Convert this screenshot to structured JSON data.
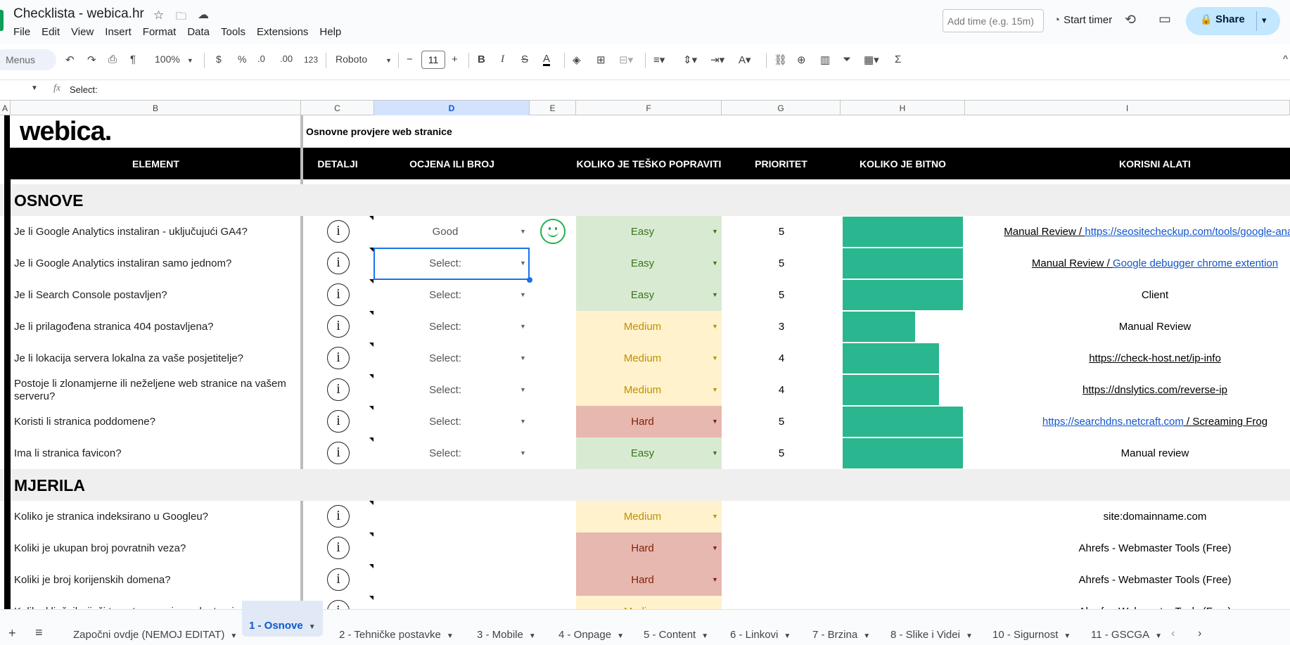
{
  "app": {
    "title": "Checklista - webica.hr",
    "menu": [
      "File",
      "Edit",
      "View",
      "Insert",
      "Format",
      "Data",
      "Tools",
      "Extensions",
      "Help"
    ],
    "add_time_placeholder": "Add time (e.g. 15m)",
    "start_timer": "Start timer",
    "share": "Share"
  },
  "toolbar": {
    "menus_search": "Menus",
    "zoom": "100%",
    "currency": "$",
    "percent": "%",
    "dec_decrease": ".0",
    "dec_increase": ".00",
    "number_format": "123",
    "font": "Roboto",
    "font_size": "11",
    "minus": "−",
    "plus": "+",
    "bold": "B",
    "italic": "I",
    "strike": "S",
    "textcolor": "A"
  },
  "formula_bar": {
    "fx": "fx",
    "value": "Select:"
  },
  "columns": [
    "A",
    "B",
    "C",
    "D",
    "E",
    "F",
    "G",
    "H",
    "I"
  ],
  "sheet": {
    "brand": "webica.",
    "subtitle": "Osnovne provjere web stranice",
    "headers": {
      "element": "ELEMENT",
      "details": "DETALJI",
      "score": "OCJENA ILI BROJ",
      "difficulty": "KOLIKO JE TEŠKO POPRAVITI",
      "priority": "PRIORITET",
      "importance": "KOLIKO JE BITNO",
      "tools": "KORISNI ALATI"
    },
    "sections": [
      {
        "label": "OSNOVE",
        "rows": [
          {
            "question": "Je li Google Analytics instaliran - uključujući GA4?",
            "score": "Good",
            "smiley": true,
            "difficulty": "Easy",
            "priority": "5",
            "importance": 1.0,
            "tools": [
              {
                "text": "Manual Review / ",
                "style": "u"
              },
              {
                "text": "https://seositecheckup.com/tools/google-analyti",
                "style": "lnk"
              }
            ]
          },
          {
            "question": "Je li Google Analytics instaliran samo jednom?",
            "score": "Select:",
            "difficulty": "Easy",
            "priority": "5",
            "importance": 1.0,
            "tools": [
              {
                "text": "Manual Review / ",
                "style": "u"
              },
              {
                "text": "Google debugger chrome extention",
                "style": "lnk"
              }
            ]
          },
          {
            "question": "Je li Search Console postavljen?",
            "score": "Select:",
            "difficulty": "Easy",
            "priority": "5",
            "importance": 1.0,
            "tools": [
              {
                "text": "Client",
                "style": ""
              }
            ]
          },
          {
            "question": "Je li prilagođena stranica 404 postavljena?",
            "score": "Select:",
            "difficulty": "Medium",
            "priority": "3",
            "importance": 0.6,
            "tools": [
              {
                "text": "Manual Review",
                "style": ""
              }
            ]
          },
          {
            "question": "Je li lokacija servera lokalna za vaše posjetitelje?",
            "score": "Select:",
            "difficulty": "Medium",
            "priority": "4",
            "importance": 0.8,
            "tools": [
              {
                "text": "https://check-host.net/ip-info",
                "style": "u"
              }
            ]
          },
          {
            "question": "Postoje li zlonamjerne ili neželjene web stranice na vašem serveru?",
            "score": "Select:",
            "difficulty": "Medium",
            "priority": "4",
            "importance": 0.8,
            "tools": [
              {
                "text": "https://dnslytics.com/reverse-ip",
                "style": "u"
              }
            ]
          },
          {
            "question": "Koristi li stranica poddomene?",
            "score": "Select:",
            "difficulty": "Hard",
            "priority": "5",
            "importance": 1.0,
            "tools": [
              {
                "text": "https://searchdns.netcraft.com",
                "style": "lnk"
              },
              {
                "text": " / Screaming Frog",
                "style": "u"
              }
            ]
          },
          {
            "question": "Ima li stranica favicon?",
            "score": "Select:",
            "difficulty": "Easy",
            "priority": "5",
            "importance": 1.0,
            "tools": [
              {
                "text": "Manual review",
                "style": ""
              }
            ]
          }
        ]
      },
      {
        "label": "MJERILA",
        "rows": [
          {
            "question": "Koliko je stranica indeksirano u Googleu?",
            "score": "",
            "difficulty": "Medium",
            "priority": "",
            "importance": 0,
            "tools": [
              {
                "text": "site:domainname.com",
                "style": ""
              }
            ]
          },
          {
            "question": "Koliki je ukupan broj povratnih veza?",
            "score": "",
            "difficulty": "Hard",
            "priority": "",
            "importance": 0,
            "tools": [
              {
                "text": "Ahrefs - Webmaster Tools (Free)",
                "style": ""
              }
            ]
          },
          {
            "question": "Koliki je broj korijenskih domena?",
            "score": "",
            "difficulty": "Hard",
            "priority": "",
            "importance": 0,
            "tools": [
              {
                "text": "Ahrefs - Webmaster Tools (Free)",
                "style": ""
              }
            ]
          },
          {
            "question": "Koliko ključnih riječi trenutno rangira web stranicu?",
            "score": "",
            "difficulty": "Medium",
            "priority": "",
            "importance": 0,
            "tools": [
              {
                "text": "Ahrefs - Webmaster Tools (Free)",
                "style": ""
              }
            ]
          }
        ]
      }
    ]
  },
  "difficulty_colors": {
    "Easy": {
      "bg": "#d9ead3",
      "fg": "#38761d"
    },
    "Medium": {
      "bg": "#fff2cc",
      "fg": "#bf9000"
    },
    "Hard": {
      "bg": "#e6b8af",
      "fg": "#85200c"
    }
  },
  "importance_color": "#2ab68e",
  "tabs": [
    {
      "label": "Započni ovdje (NEMOJ EDITAT)",
      "active": false
    },
    {
      "label": "1 - Osnove",
      "active": true
    },
    {
      "label": "2 - Tehničke postavke",
      "active": false
    },
    {
      "label": "3 - Mobile",
      "active": false
    },
    {
      "label": "4 - Onpage",
      "active": false
    },
    {
      "label": "5 - Content",
      "active": false
    },
    {
      "label": "6 - Linkovi",
      "active": false
    },
    {
      "label": "7 - Brzina",
      "active": false
    },
    {
      "label": "8 - Slike i Videi",
      "active": false
    },
    {
      "label": "10 - Sigurnost",
      "active": false
    },
    {
      "label": "11 - GSCGA",
      "active": false
    }
  ],
  "icons": {
    "star": "star-icon",
    "move": "move-folder-icon",
    "cloud": "cloud-status-icon",
    "history": "history-icon",
    "comment": "comment-icon",
    "lock": "lock-icon",
    "info": "info-icon",
    "smiley": "smiley-icon"
  }
}
